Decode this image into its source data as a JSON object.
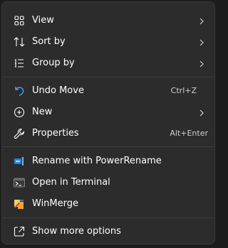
{
  "menu": {
    "items": [
      {
        "label": "View",
        "icon": "view-grid-icon",
        "submenu": true
      },
      {
        "label": "Sort by",
        "icon": "sort-icon",
        "submenu": true
      },
      {
        "label": "Group by",
        "icon": "group-list-icon",
        "submenu": true
      },
      {
        "label": "Undo Move",
        "icon": "undo-icon",
        "shortcut": "Ctrl+Z"
      },
      {
        "label": "New",
        "icon": "new-plus-icon",
        "submenu": true
      },
      {
        "label": "Properties",
        "icon": "properties-wrench-icon",
        "shortcut": "Alt+Enter"
      },
      {
        "label": "Rename with PowerRename",
        "icon": "powerrename-icon"
      },
      {
        "label": "Open in Terminal",
        "icon": "terminal-icon"
      },
      {
        "label": "WinMerge",
        "icon": "winmerge-icon"
      },
      {
        "label": "Show more options",
        "icon": "show-more-options-icon"
      }
    ]
  },
  "colors": {
    "menu_bg": "#2c2c2c",
    "separator": "#3d3d3d",
    "icon_blue": "#4aa3ff",
    "text": "#ffffff"
  }
}
